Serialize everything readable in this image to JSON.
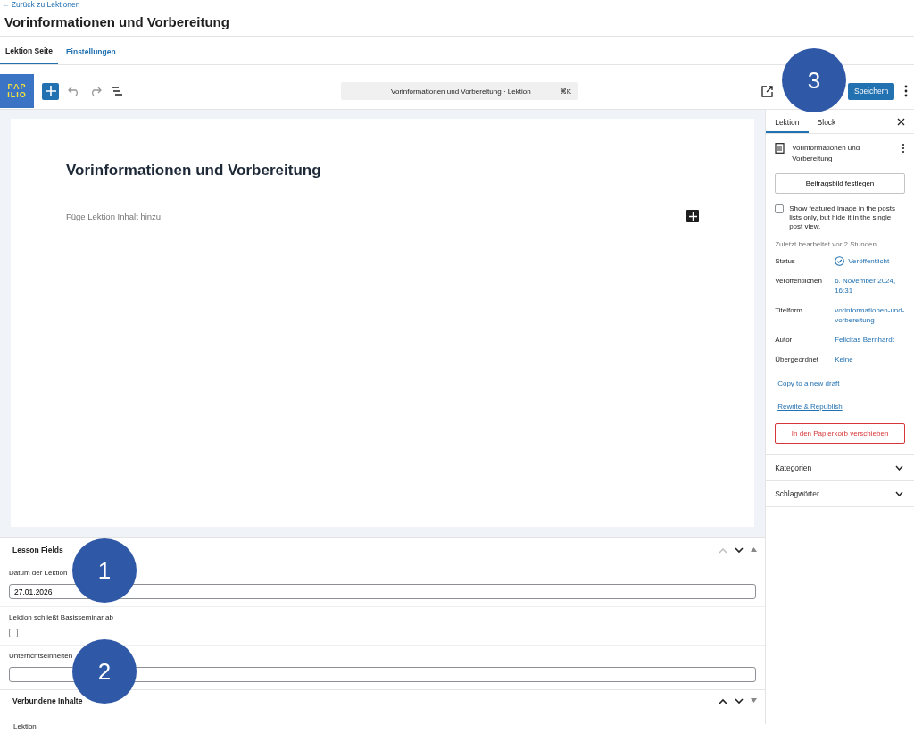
{
  "header": {
    "back_link": "← Zurück zu Lektionen",
    "title": "Vorinformationen und Vorbereitung"
  },
  "page_tabs": [
    {
      "label": "Lektion Seite",
      "selected": true
    },
    {
      "label": "Einstellungen",
      "selected": false
    }
  ],
  "toolbar": {
    "logo": [
      "PAP",
      "ILIO"
    ],
    "command_bar": "Vorinformationen und Vorbereitung · Lektion",
    "shortcut": "⌘K",
    "save_button": "Speichern"
  },
  "editor": {
    "title": "Vorinformationen und Vorbereitung",
    "placeholder": "Füge Lektion Inhalt hinzu."
  },
  "sidebar": {
    "tabs": [
      {
        "label": "Lektion",
        "selected": true
      },
      {
        "label": "Block",
        "selected": false
      }
    ],
    "post_title": "Vorinformationen und Vorbereitung",
    "featured_button": "Beitragsbild festlegen",
    "featured_option": {
      "label": "Show featured image in the posts lists only, but hide it in the single post view.",
      "checked": false
    },
    "last_edited": "Zuletzt bearbeitet vor 2 Stunden.",
    "meta": [
      {
        "label": "Status",
        "value": "Veröffentlicht",
        "kind": "status"
      },
      {
        "label": "Veröffentlichen",
        "value": "6. November 2024, 16:31",
        "kind": "link"
      },
      {
        "label": "Titelform",
        "value": "vorinformationen-und-vorbereitung",
        "kind": "link"
      },
      {
        "label": "Autor",
        "value": "Felicitas Bernhardt",
        "kind": "link"
      },
      {
        "label": "Übergeordnet",
        "value": "Keine",
        "kind": "link"
      }
    ],
    "links": [
      "Copy to a new draft",
      "Rewrite & Republish"
    ],
    "trash_button": "In den Papierkorb verschieben",
    "panels": [
      {
        "label": "Kategorien",
        "expanded": false
      },
      {
        "label": "Schlagwörter",
        "expanded": false
      }
    ]
  },
  "lesson_fields": {
    "title": "Lesson Fields",
    "expanded": true,
    "fields": [
      {
        "label": "Datum der Lektion",
        "kind": "text",
        "value": "27.01.2026"
      },
      {
        "label": "Lektion schließt Basisseminar ab",
        "kind": "checkbox",
        "checked": false
      },
      {
        "label": "Unterrichtseinheiten",
        "kind": "text"
      }
    ]
  },
  "related": {
    "title": "Verbundene Inhalte",
    "expanded": false
  },
  "footer": "Lektion",
  "annotations": [
    "3",
    "1",
    "2"
  ]
}
